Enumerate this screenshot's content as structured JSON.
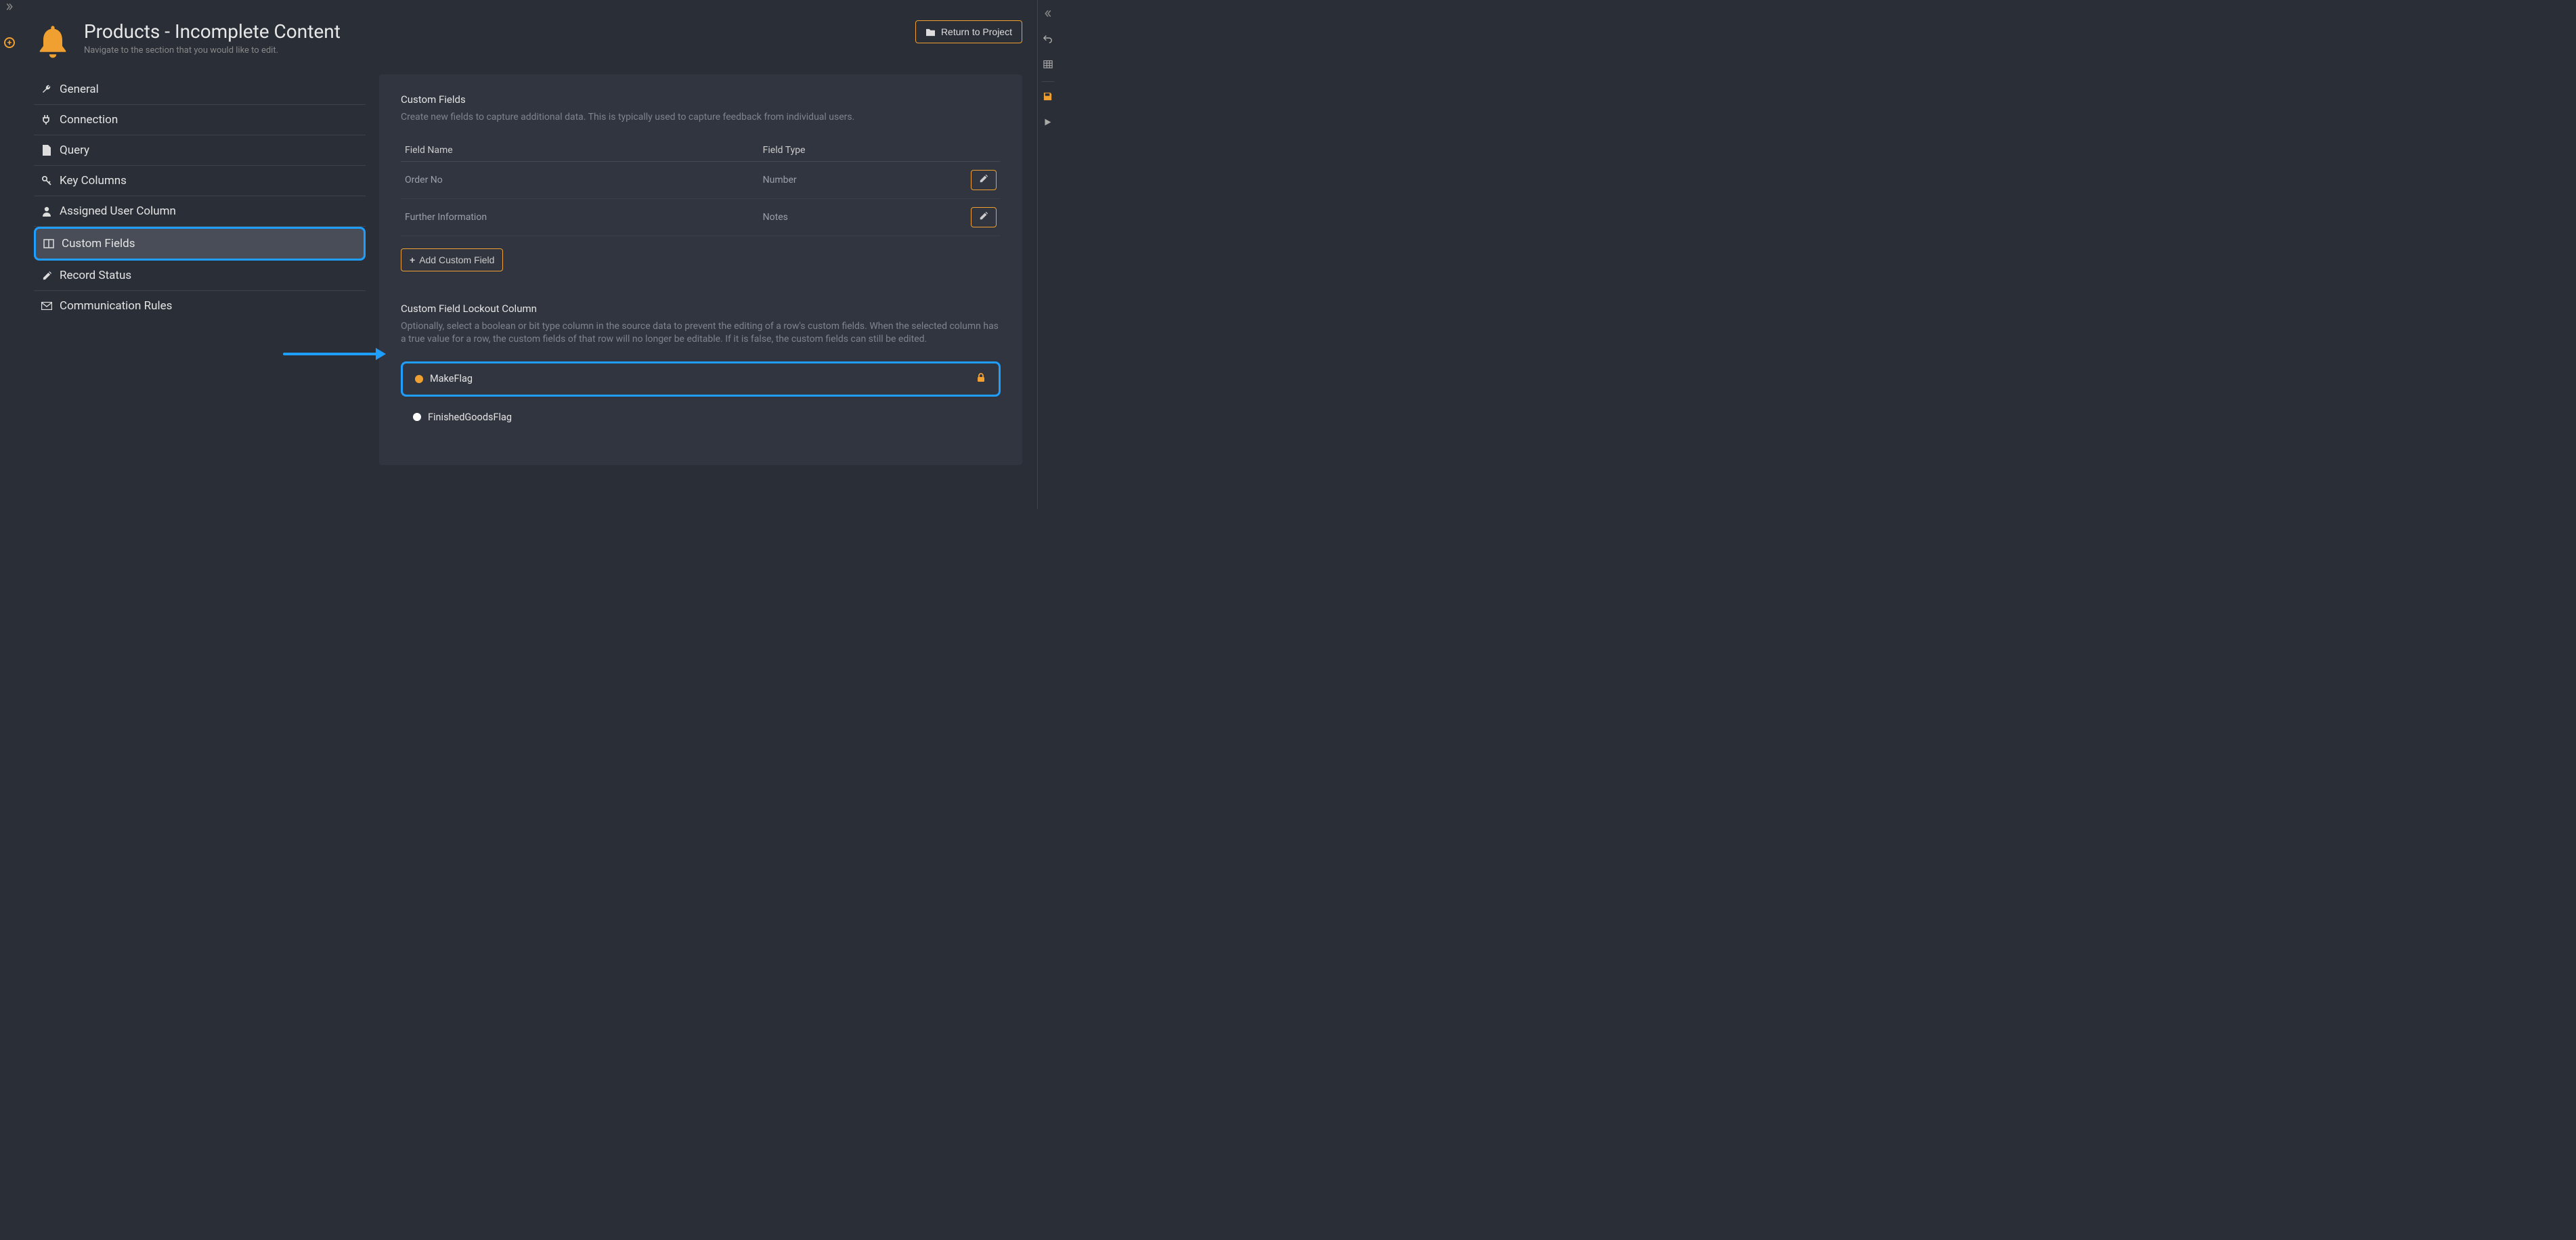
{
  "header": {
    "title": "Products - Incomplete Content",
    "subtitle": "Navigate to the section that you would like to edit.",
    "return_label": "Return to Project"
  },
  "sidebar": {
    "general": "General",
    "connection": "Connection",
    "query": "Query",
    "key_columns": "Key Columns",
    "assigned_user": "Assigned User Column",
    "custom_fields": "Custom Fields",
    "record_status": "Record Status",
    "comm_rules": "Communication Rules"
  },
  "cf": {
    "heading": "Custom Fields",
    "desc": "Create new fields to capture additional data. This is typically used to capture feedback from individual users.",
    "col_name": "Field Name",
    "col_type": "Field Type",
    "rows": [
      {
        "name": "Order No",
        "type": "Number"
      },
      {
        "name": "Further Information",
        "type": "Notes"
      }
    ],
    "add_label": "Add Custom Field"
  },
  "lockout": {
    "heading": "Custom Field Lockout Column",
    "desc": "Optionally, select a boolean or bit type column in the source data to prevent the editing of a row's custom fields. When the selected column has a true value for a row, the custom fields of that row will no longer be editable. If it is false, the custom fields can still be edited.",
    "opt1": "MakeFlag",
    "opt2": "FinishedGoodsFlag"
  }
}
